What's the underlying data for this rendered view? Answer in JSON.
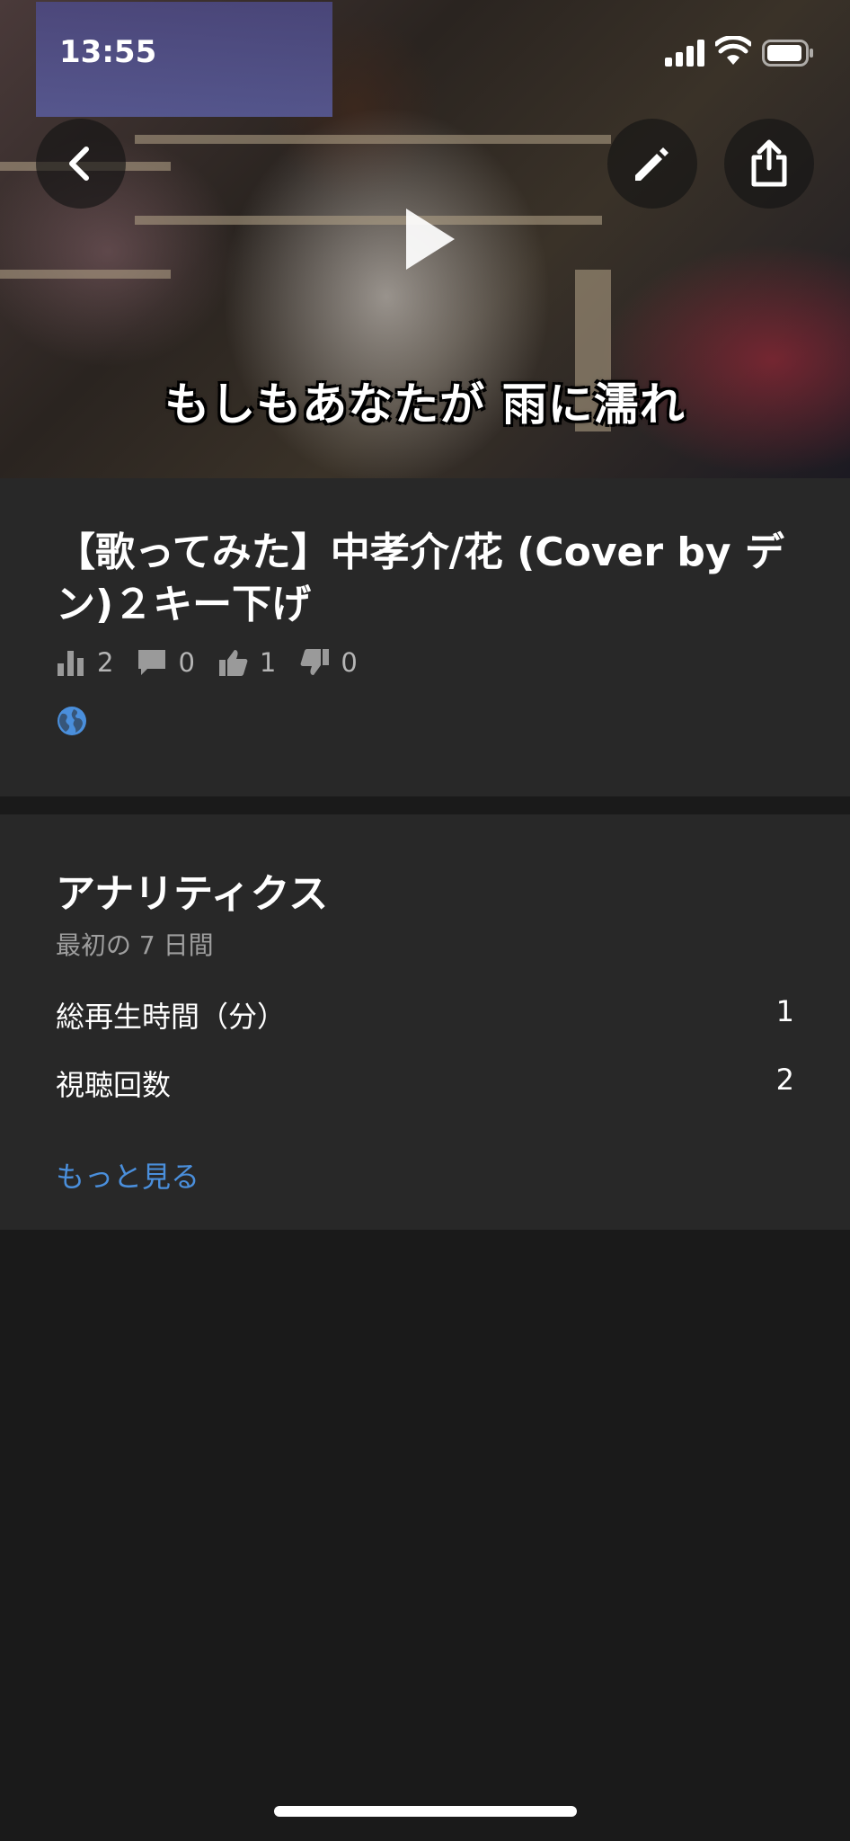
{
  "status_bar": {
    "time": "13:55",
    "icons": [
      "signal-icon",
      "wifi-icon",
      "battery-icon"
    ]
  },
  "video": {
    "caption": "もしもあなたが 雨に濡れ",
    "buttons": [
      "back-icon",
      "pencil-icon",
      "share-icon",
      "play-icon"
    ]
  },
  "info": {
    "title": "【歌ってみた】中孝介/花 (Cover by デン)２キー下げ",
    "views": "2",
    "comments": "0",
    "likes": "1",
    "dislikes": "0",
    "visibility_icon": "globe-icon"
  },
  "analytics": {
    "title": "アナリティクス",
    "subtitle": "最初の 7 日間",
    "metrics": [
      {
        "label": "総再生時間（分）",
        "value": "1"
      },
      {
        "label": "視聴回数",
        "value": "2"
      }
    ],
    "see_more": "もっと見る"
  },
  "colors": {
    "background": "#1a1a1a",
    "card": "#282828",
    "link": "#4a8fdc",
    "globe": "#4a8fdc",
    "muted_text": "#9e9e9e"
  }
}
